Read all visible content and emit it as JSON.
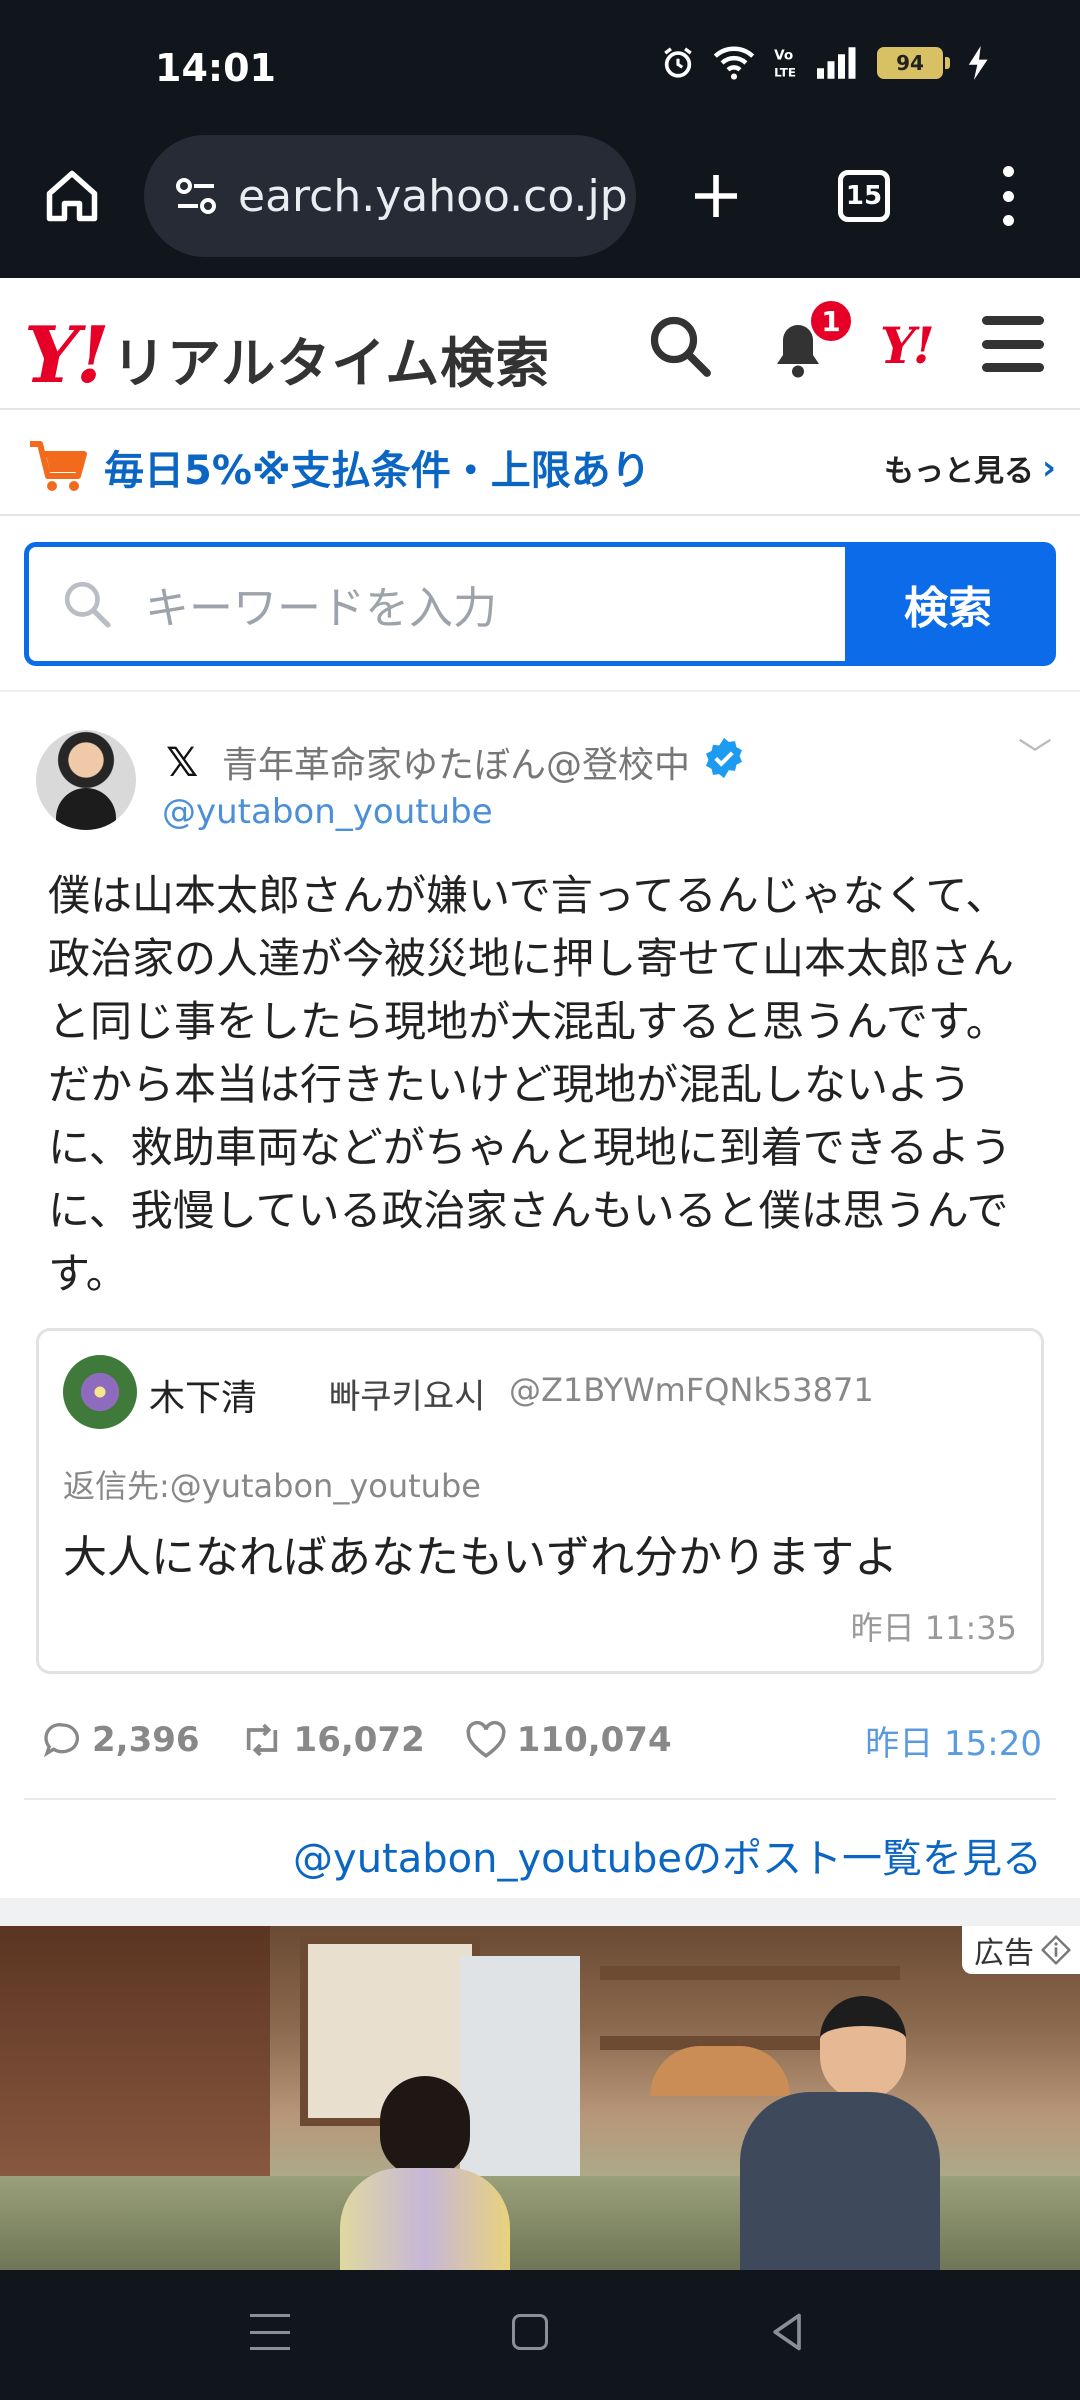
{
  "status_bar": {
    "time": "14:01",
    "battery": "94",
    "icons": [
      "alarm-icon",
      "wifi-icon",
      "volte-icon",
      "signal-icon",
      "battery-icon",
      "charging-icon"
    ]
  },
  "browser": {
    "url": "earch.yahoo.co.jp",
    "tab_count": "15"
  },
  "header": {
    "logo_mark": "Y!",
    "logo_text": "リアルタイム検索",
    "notification_count": "1",
    "mini_logo": "Y!"
  },
  "promo": {
    "text": "毎日5%※支払条件・上限あり",
    "more": "もっと見る"
  },
  "search": {
    "placeholder": "キーワードを入力",
    "button": "検索"
  },
  "post": {
    "platform": "𝕏",
    "author_name": "青年革命家ゆたぼん@登校中",
    "author_handle": "@yutabon_youtube",
    "body": "僕は山本太郎さんが嫌いで言ってるんじゃなくて、政治家の人達が今被災地に押し寄せて山本太郎さんと同じ事をしたら現地が大混乱すると思うんです。だから本当は行きたいけど現地が混乱しないように、救助車両などがちゃんと現地に到着できるように、我慢している政治家さんもいると僕は思うんです。",
    "quote": {
      "name": "木下清",
      "name_korean": "빠쿠키요시",
      "handle": "@Z1BYWmFQNk53871",
      "reply_to": "返信先:@yutabon_youtube",
      "text": "大人になればあなたもいずれ分かりますよ",
      "time": "昨日 11:35"
    },
    "replies": "2,396",
    "reposts": "16,072",
    "likes": "110,074",
    "time": "昨日 15:20",
    "link": "@yutabon_youtubeのポスト一覧を見る"
  },
  "ad": {
    "label": "広告"
  },
  "colors": {
    "yahoo_red": "#e60027",
    "link_blue": "#0b66c3",
    "search_blue": "#0b6be8",
    "chrome_dark": "#11151c"
  }
}
